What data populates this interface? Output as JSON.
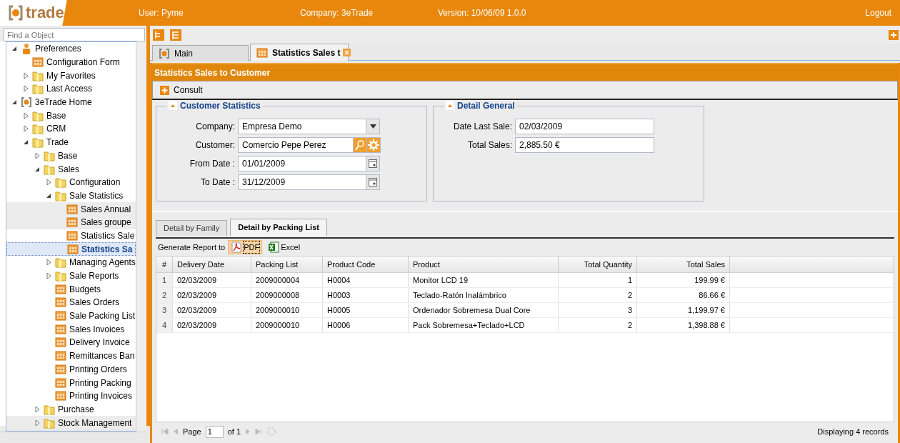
{
  "header": {
    "logo_text": "trade",
    "user": "User: Pyme",
    "company": "Company: 3eTrade",
    "version": "Version: 10/06/09 1.0.0",
    "logout": "Logout"
  },
  "sidebar": {
    "search": {
      "placeholder": "Find a Object"
    },
    "tree": [
      {
        "label": "Preferences",
        "kind": "person",
        "expanded": true,
        "selected": false,
        "shaded": false,
        "children": [
          {
            "label": "Configuration Form",
            "kind": "form",
            "selected": false,
            "shaded": false
          },
          {
            "label": "My Favorites",
            "kind": "folder",
            "expanded": false,
            "selected": false,
            "shaded": false
          },
          {
            "label": "Last Access",
            "kind": "folder",
            "expanded": false,
            "selected": false,
            "shaded": false
          }
        ]
      },
      {
        "label": "3eTrade Home",
        "kind": "logo",
        "expanded": true,
        "selected": false,
        "shaded": false,
        "children": [
          {
            "label": "Base",
            "kind": "folder",
            "expanded": false,
            "selected": false,
            "shaded": false
          },
          {
            "label": "CRM",
            "kind": "folder",
            "expanded": false,
            "selected": false,
            "shaded": false
          },
          {
            "label": "Trade",
            "kind": "folder",
            "expanded": true,
            "selected": false,
            "shaded": false,
            "children": [
              {
                "label": "Base",
                "kind": "folder",
                "expanded": false,
                "selected": false,
                "shaded": false
              },
              {
                "label": "Sales",
                "kind": "folder",
                "expanded": true,
                "selected": false,
                "shaded": false,
                "children": [
                  {
                    "label": "Configuration",
                    "kind": "folder",
                    "expanded": false,
                    "selected": false,
                    "shaded": false
                  },
                  {
                    "label": "Sale Statistics",
                    "kind": "folder",
                    "expanded": true,
                    "selected": false,
                    "shaded": false,
                    "children": [
                      {
                        "label": "Sales Annual",
                        "kind": "form",
                        "selected": false,
                        "shaded": true
                      },
                      {
                        "label": "Sales groupe",
                        "kind": "form",
                        "selected": false,
                        "shaded": true
                      },
                      {
                        "label": "Statistics Sale",
                        "kind": "form",
                        "selected": false,
                        "shaded": false
                      },
                      {
                        "label": "Statistics Sa",
                        "kind": "form",
                        "selected": true,
                        "shaded": false
                      }
                    ]
                  },
                  {
                    "label": "Managing Agents",
                    "kind": "folder",
                    "expanded": false,
                    "selected": false,
                    "shaded": false
                  },
                  {
                    "label": "Sale Reports",
                    "kind": "folder",
                    "expanded": false,
                    "selected": false,
                    "shaded": false
                  },
                  {
                    "label": "Budgets",
                    "kind": "form",
                    "selected": false,
                    "shaded": false
                  },
                  {
                    "label": "Sales Orders",
                    "kind": "form",
                    "selected": false,
                    "shaded": false
                  },
                  {
                    "label": "Sale Packing List",
                    "kind": "form",
                    "selected": false,
                    "shaded": false
                  },
                  {
                    "label": "Sales Invoices",
                    "kind": "form",
                    "selected": false,
                    "shaded": false
                  },
                  {
                    "label": "Delivery Invoice",
                    "kind": "form",
                    "selected": false,
                    "shaded": false
                  },
                  {
                    "label": "Remittances Ban",
                    "kind": "form",
                    "selected": false,
                    "shaded": false
                  },
                  {
                    "label": "Printing Orders",
                    "kind": "form",
                    "selected": false,
                    "shaded": false
                  },
                  {
                    "label": "Printing Packing",
                    "kind": "form",
                    "selected": false,
                    "shaded": false
                  },
                  {
                    "label": "Printing Invoices",
                    "kind": "form",
                    "selected": false,
                    "shaded": false
                  }
                ]
              },
              {
                "label": "Purchase",
                "kind": "folder",
                "expanded": false,
                "selected": false,
                "shaded": false
              },
              {
                "label": "Stock Management",
                "kind": "folder",
                "expanded": false,
                "selected": false,
                "shaded": true
              }
            ]
          }
        ]
      }
    ]
  },
  "tabs": [
    {
      "label": "Main",
      "kind": "logo",
      "selected": false,
      "closable": false
    },
    {
      "label": "Statistics Sales t",
      "kind": "form",
      "selected": true,
      "closable": true
    }
  ],
  "panel": {
    "title": "Statistics Sales to Customer",
    "toolbar": [
      {
        "label": "Consult"
      }
    ],
    "fieldsets": [
      {
        "title": "Customer Statistics",
        "fields": [
          {
            "label": "Company:",
            "value": "Empresa Demo",
            "kind": "combo"
          },
          {
            "label": "Customer:",
            "value": "Comercio Pepe Perez",
            "kind": "lookup"
          },
          {
            "label": "From Date :",
            "value": "01/01/2009",
            "kind": "date"
          },
          {
            "label": "To Date :",
            "value": "31/12/2009",
            "kind": "date"
          }
        ]
      },
      {
        "title": "Detail General",
        "fields": [
          {
            "label": "Date Last Sale:",
            "value": "02/03/2009",
            "kind": "text"
          },
          {
            "label": "Total Sales:",
            "value": "2,885.50 €",
            "kind": "text"
          }
        ]
      }
    ],
    "subtabs": [
      {
        "label": "Detail by Family",
        "selected": false
      },
      {
        "label": "Detail by Packing List",
        "selected": true
      }
    ],
    "report": {
      "label": "Generate Report to",
      "buttons": [
        {
          "label": "PDF",
          "kind": "pdf",
          "pressed": true
        },
        {
          "label": "Excel",
          "kind": "excel",
          "pressed": false
        }
      ]
    },
    "table": {
      "columns": [
        "#",
        "Delivery Date",
        "Packing List",
        "Product Code",
        "Product",
        "Total Quantity",
        "Total Sales"
      ],
      "rows": [
        [
          "1",
          "02/03/2009",
          "2009000004",
          "H0004",
          "Monitor LCD 19",
          "1",
          "199.99 €"
        ],
        [
          "2",
          "02/03/2009",
          "2009000008",
          "H0003",
          "Teclado-Ratón Inalámbrico",
          "2",
          "86.66 €"
        ],
        [
          "3",
          "02/03/2009",
          "2009000010",
          "H0005",
          "Ordenador Sobremesa Dual Core",
          "3",
          "1,199.97 €"
        ],
        [
          "4",
          "02/03/2009",
          "2009000010",
          "H0006",
          "Pack Sobremesa+Teclado+LCD",
          "2",
          "1,398.88 €"
        ]
      ]
    },
    "paging": {
      "page_label": "Page",
      "page": "1",
      "of": "of 1",
      "status": "Displaying 4 records"
    }
  }
}
